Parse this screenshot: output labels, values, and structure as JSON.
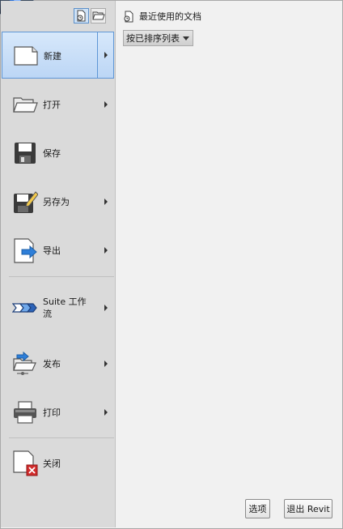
{
  "menu": {
    "items": [
      {
        "label": "新建",
        "icon": "new-document-icon",
        "has_submenu": true,
        "selected": true
      },
      {
        "label": "打开",
        "icon": "open-folder-icon",
        "has_submenu": true
      },
      {
        "label": "保存",
        "icon": "save-disk-icon",
        "has_submenu": false
      },
      {
        "label": "另存为",
        "icon": "save-as-icon",
        "has_submenu": true
      },
      {
        "label": "导出",
        "icon": "export-icon",
        "has_submenu": true
      },
      {
        "label": "Suite 工作流",
        "icon": "suite-workflow-icon",
        "has_submenu": true
      },
      {
        "label": "发布",
        "icon": "publish-icon",
        "has_submenu": true
      },
      {
        "label": "打印",
        "icon": "printer-icon",
        "has_submenu": true
      },
      {
        "label": "关闭",
        "icon": "close-document-icon",
        "has_submenu": false
      }
    ]
  },
  "panel": {
    "title": "最近使用的文档",
    "sort_value": "按已排序列表"
  },
  "buttons": {
    "options": "选项",
    "exit": "退出 Revit"
  },
  "colors": {
    "menu_bg": "#dadada",
    "panel_bg": "#f1f1f1",
    "selected_bg": "#cfe2f6",
    "selected_border": "#5e96d6"
  }
}
